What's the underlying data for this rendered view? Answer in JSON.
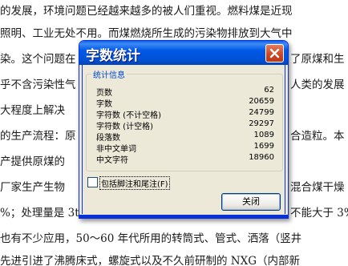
{
  "document": {
    "lines": [
      "的发展，环境问题已经越来越多的被人们重视。燃料煤是近现",
      "照明、工业无处不用。而煤燃烧所生成的污染物排放到大气中",
      "染。这个问题在",
      "乎不含污染性气",
      "大程度上解决",
      "的生产流程：原",
      "产提供原煤的",
      "厂家生产生物",
      "%；处理量是 3t",
      "也有不少应用，50～60 年代所用的转筒式、管式、洒落（竖井",
      "先进引进了沸腾床式，螺旋式以及不久前研制的 NXG（内部新"
    ],
    "right_fragments": [
      "了原煤和生",
      "人类的发展",
      "合造粒。本",
      "混合煤干燥",
      "不能大于 3%"
    ]
  },
  "dialog": {
    "title": "字数统计",
    "group_label": "统计信息",
    "stats": [
      {
        "label": "页数",
        "value": "62"
      },
      {
        "label": "字数",
        "value": "20659"
      },
      {
        "label": "字符数 (不计空格)",
        "value": "24799"
      },
      {
        "label": "字符数 (计空格)",
        "value": "29297"
      },
      {
        "label": "段落数",
        "value": "1089"
      },
      {
        "label": "非中文单词",
        "value": "1699"
      },
      {
        "label": "中文字符",
        "value": "18960"
      }
    ],
    "checkbox_label": "包括脚注和尾注(F)",
    "checkbox_checked": false,
    "close_button": "关闭",
    "close_icon": "close-x-icon",
    "accent_color": "#0058e6",
    "close_color": "#cc4422"
  }
}
